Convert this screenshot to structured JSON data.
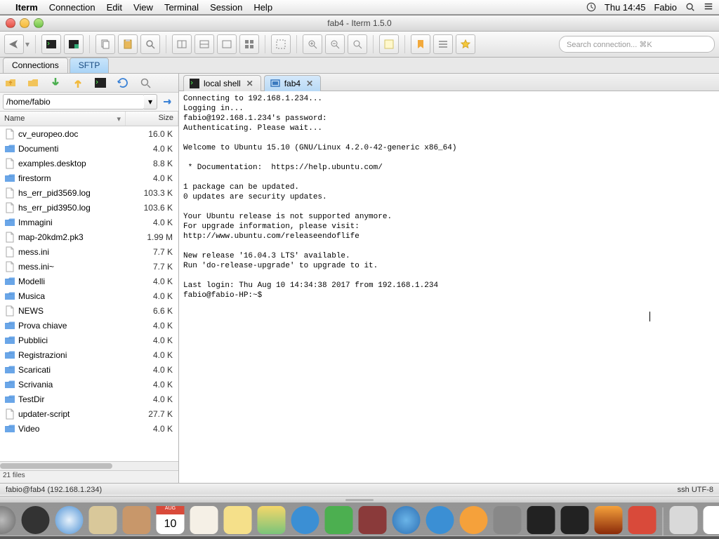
{
  "menubar": {
    "app": "Iterm",
    "items": [
      "Connection",
      "Edit",
      "View",
      "Terminal",
      "Session",
      "Help"
    ],
    "clock": "Thu 14:45",
    "user": "Fabio"
  },
  "window": {
    "title": "fab4 - Iterm 1.5.0",
    "search_placeholder": "Search connection... ⌘K"
  },
  "sftp": {
    "tabs": [
      "Connections",
      "SFTP"
    ],
    "active_tab": 1,
    "path": "/home/fabio",
    "columns": [
      "Name",
      "Size"
    ],
    "files": [
      {
        "name": "cv_europeo.doc",
        "size": "16.0 K",
        "type": "file"
      },
      {
        "name": "Documenti",
        "size": "4.0 K",
        "type": "folder"
      },
      {
        "name": "examples.desktop",
        "size": "8.8 K",
        "type": "file"
      },
      {
        "name": "firestorm",
        "size": "4.0 K",
        "type": "folder"
      },
      {
        "name": "hs_err_pid3569.log",
        "size": "103.3 K",
        "type": "file"
      },
      {
        "name": "hs_err_pid3950.log",
        "size": "103.6 K",
        "type": "file"
      },
      {
        "name": "Immagini",
        "size": "4.0 K",
        "type": "folder"
      },
      {
        "name": "map-20kdm2.pk3",
        "size": "1.99 M",
        "type": "file"
      },
      {
        "name": "mess.ini",
        "size": "7.7 K",
        "type": "file"
      },
      {
        "name": "mess.ini~",
        "size": "7.7 K",
        "type": "file"
      },
      {
        "name": "Modelli",
        "size": "4.0 K",
        "type": "folder"
      },
      {
        "name": "Musica",
        "size": "4.0 K",
        "type": "folder"
      },
      {
        "name": "NEWS",
        "size": "6.6 K",
        "type": "file"
      },
      {
        "name": "Prova chiave",
        "size": "4.0 K",
        "type": "folder"
      },
      {
        "name": "Pubblici",
        "size": "4.0 K",
        "type": "folder"
      },
      {
        "name": "Registrazioni",
        "size": "4.0 K",
        "type": "folder"
      },
      {
        "name": "Scaricati",
        "size": "4.0 K",
        "type": "folder"
      },
      {
        "name": "Scrivania",
        "size": "4.0 K",
        "type": "folder"
      },
      {
        "name": "TestDir",
        "size": "4.0 K",
        "type": "folder"
      },
      {
        "name": "updater-script",
        "size": "27.7 K",
        "type": "file"
      },
      {
        "name": "Video",
        "size": "4.0 K",
        "type": "folder"
      }
    ],
    "status": "21 files"
  },
  "term_tabs": {
    "items": [
      "local shell",
      "fab4"
    ],
    "active": 1
  },
  "terminal": "Connecting to 192.168.1.234...\nLogging in...\nfabio@192.168.1.234's password:\nAuthenticating. Please wait...\n\nWelcome to Ubuntu 15.10 (GNU/Linux 4.2.0-42-generic x86_64)\n\n * Documentation:  https://help.ubuntu.com/\n\n1 package can be updated.\n0 updates are security updates.\n\nYour Ubuntu release is not supported anymore.\nFor upgrade information, please visit:\nhttp://www.ubuntu.com/releaseendoflife\n\nNew release '16.04.3 LTS' available.\nRun 'do-release-upgrade' to upgrade to it.\n\nLast login: Thu Aug 10 14:34:38 2017 from 192.168.1.234\nfabio@fabio-HP:~$ ",
  "statusbar": {
    "left": "fabio@fab4 (192.168.1.234)",
    "right": "ssh  UTF-8"
  },
  "dock": [
    "finder",
    "launchpad",
    "mission",
    "safari",
    "mail",
    "contacts",
    "calendar",
    "reminders",
    "notes",
    "maps",
    "messages",
    "facetime",
    "photobooth",
    "itunes",
    "appstore",
    "ibooks",
    "preferences",
    "terminal",
    "terminal2",
    "fire",
    "filezilla",
    "folder",
    "pages",
    "trash"
  ]
}
